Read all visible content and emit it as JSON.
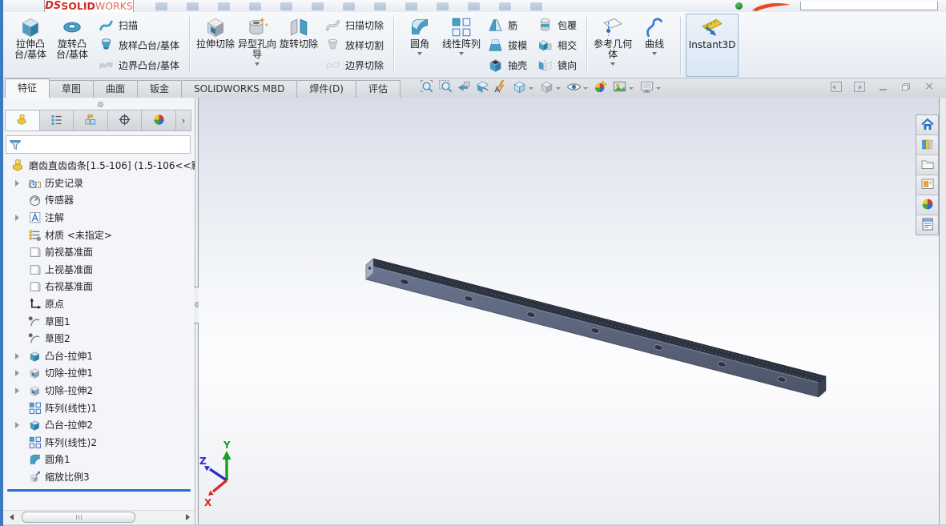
{
  "logo": {
    "ds": "DS ",
    "solid": "SOLID",
    "works": "WORKS"
  },
  "command_manager": {
    "groups": [
      {
        "big": [
          {
            "name": "extruded-boss-base",
            "label": "拉伸凸台/基体",
            "icon": "extruded-boss"
          },
          {
            "name": "revolved-boss-base",
            "label": "旋转凸台/基体",
            "icon": "revolved-boss"
          }
        ],
        "cols": [
          [
            {
              "name": "swept-boss-base",
              "label": "扫描",
              "icon": "sweep"
            },
            {
              "name": "lofted-boss-base",
              "label": "放样凸台/基体",
              "icon": "loft"
            },
            {
              "name": "boundary-boss-base",
              "label": "边界凸台/基体",
              "icon": "boundary"
            }
          ]
        ]
      },
      {
        "big": [
          {
            "name": "extruded-cut",
            "label": "拉伸切除",
            "icon": "extruded-cut"
          },
          {
            "name": "hole-wizard",
            "label": "异型孔向导",
            "icon": "hole-wizard",
            "dropdown": true
          },
          {
            "name": "revolved-cut",
            "label": "旋转切除",
            "icon": "revolved-cut"
          }
        ],
        "cols": [
          [
            {
              "name": "swept-cut",
              "label": "扫描切除",
              "icon": "swept-cut"
            },
            {
              "name": "lofted-cut",
              "label": "放样切割",
              "icon": "lofted-cut"
            },
            {
              "name": "boundary-cut",
              "label": "边界切除",
              "icon": "boundary-cut"
            }
          ]
        ]
      },
      {
        "big": [
          {
            "name": "fillet",
            "label": "圆角",
            "icon": "fillet",
            "dropdown": true
          },
          {
            "name": "linear-pattern",
            "label": "线性阵列",
            "icon": "linear-pattern",
            "dropdown": true
          }
        ],
        "cols": [
          [
            {
              "name": "rib",
              "label": "筋",
              "icon": "rib"
            },
            {
              "name": "draft",
              "label": "拔模",
              "icon": "draft"
            },
            {
              "name": "shell",
              "label": "抽壳",
              "icon": "shell"
            }
          ],
          [
            {
              "name": "wrap",
              "label": "包覆",
              "icon": "wrap"
            },
            {
              "name": "intersect",
              "label": "相交",
              "icon": "intersect"
            },
            {
              "name": "mirror",
              "label": "镜向",
              "icon": "mirror"
            }
          ]
        ]
      },
      {
        "big": [
          {
            "name": "reference-geometry",
            "label": "参考几何体",
            "icon": "reference-geometry",
            "dropdown": true
          },
          {
            "name": "curves",
            "label": "曲线",
            "icon": "curves",
            "dropdown": true
          }
        ],
        "cols": []
      },
      {
        "big": [
          {
            "name": "instant3d",
            "label": "Instant3D",
            "icon": "instant3d",
            "active": true
          }
        ],
        "cols": []
      }
    ]
  },
  "tabs": {
    "items": [
      {
        "name": "features",
        "label": "特征",
        "active": true
      },
      {
        "name": "sketch",
        "label": "草图"
      },
      {
        "name": "surfaces",
        "label": "曲面"
      },
      {
        "name": "sheet-metal",
        "label": "钣金"
      },
      {
        "name": "solidworks-mbd",
        "label": "SOLIDWORKS MBD"
      },
      {
        "name": "weldments",
        "label": "焊件(D)"
      },
      {
        "name": "evaluate",
        "label": "评估"
      }
    ]
  },
  "headsup": {
    "icons": [
      {
        "name": "zoom-to-fit"
      },
      {
        "name": "zoom-to-area"
      },
      {
        "name": "previous-view"
      },
      {
        "name": "section-view"
      },
      {
        "name": "dynamic-annotation-views"
      },
      {
        "name": "view-orientation",
        "dropdown": true
      },
      {
        "name": "display-style",
        "dropdown": true
      },
      {
        "name": "hide-show-items",
        "dropdown": true
      },
      {
        "name": "edit-appearance"
      },
      {
        "name": "apply-scene",
        "dropdown": true
      },
      {
        "name": "view-settings",
        "dropdown": true
      }
    ]
  },
  "window_controls": [
    {
      "name": "collapse-panel-left"
    },
    {
      "name": "collapse-panel-right"
    },
    {
      "name": "minimize-window"
    },
    {
      "name": "restore-window"
    },
    {
      "name": "close-window"
    }
  ],
  "feature_tree": {
    "manager_tabs": [
      {
        "name": "featuremanager-design-tree",
        "active": true
      },
      {
        "name": "propertymanager"
      },
      {
        "name": "configurationmanager"
      },
      {
        "name": "dimxpertmanager"
      },
      {
        "name": "displaymanager"
      }
    ],
    "filter": {
      "value": ""
    },
    "root": "磨齿直齿齿条[1.5-106]  (1.5-106<<默",
    "items": [
      {
        "name": "history",
        "label": "历史记录",
        "icon": "history",
        "arrow": true
      },
      {
        "name": "sensors",
        "label": "传感器",
        "icon": "sensors"
      },
      {
        "name": "annotations",
        "label": "注解",
        "icon": "annotations",
        "arrow": true
      },
      {
        "name": "material",
        "label": "材质 <未指定>",
        "icon": "material"
      },
      {
        "name": "front-plane",
        "label": "前视基准面",
        "icon": "plane"
      },
      {
        "name": "top-plane",
        "label": "上视基准面",
        "icon": "plane"
      },
      {
        "name": "right-plane",
        "label": "右视基准面",
        "icon": "plane"
      },
      {
        "name": "origin",
        "label": "原点",
        "icon": "origin"
      },
      {
        "name": "sketch1",
        "label": "草图1",
        "icon": "sketch"
      },
      {
        "name": "sketch2",
        "label": "草图2",
        "icon": "sketch"
      },
      {
        "name": "boss-extrude1",
        "label": "凸台-拉伸1",
        "icon": "boss-extrude",
        "arrow": true
      },
      {
        "name": "cut-extrude1",
        "label": "切除-拉伸1",
        "icon": "cut-extrude",
        "arrow": true
      },
      {
        "name": "cut-extrude2",
        "label": "切除-拉伸2",
        "icon": "cut-extrude",
        "arrow": true
      },
      {
        "name": "lpattern1",
        "label": "阵列(线性)1",
        "icon": "lpattern"
      },
      {
        "name": "boss-extrude2",
        "label": "凸台-拉伸2",
        "icon": "boss-extrude",
        "arrow": true
      },
      {
        "name": "lpattern2",
        "label": "阵列(线性)2",
        "icon": "lpattern"
      },
      {
        "name": "fillet1",
        "label": "圆角1",
        "icon": "fillet-s"
      },
      {
        "name": "scale3",
        "label": "缩放比例3",
        "icon": "scale"
      }
    ]
  },
  "task_pane": {
    "icons": [
      {
        "name": "home"
      },
      {
        "name": "design-library"
      },
      {
        "name": "file-explorer"
      },
      {
        "name": "view-palette"
      },
      {
        "name": "appearances-scenes"
      },
      {
        "name": "custom-properties"
      }
    ]
  },
  "viewport": {
    "triad": {
      "x": "X",
      "y": "Y",
      "z": "Z"
    }
  }
}
